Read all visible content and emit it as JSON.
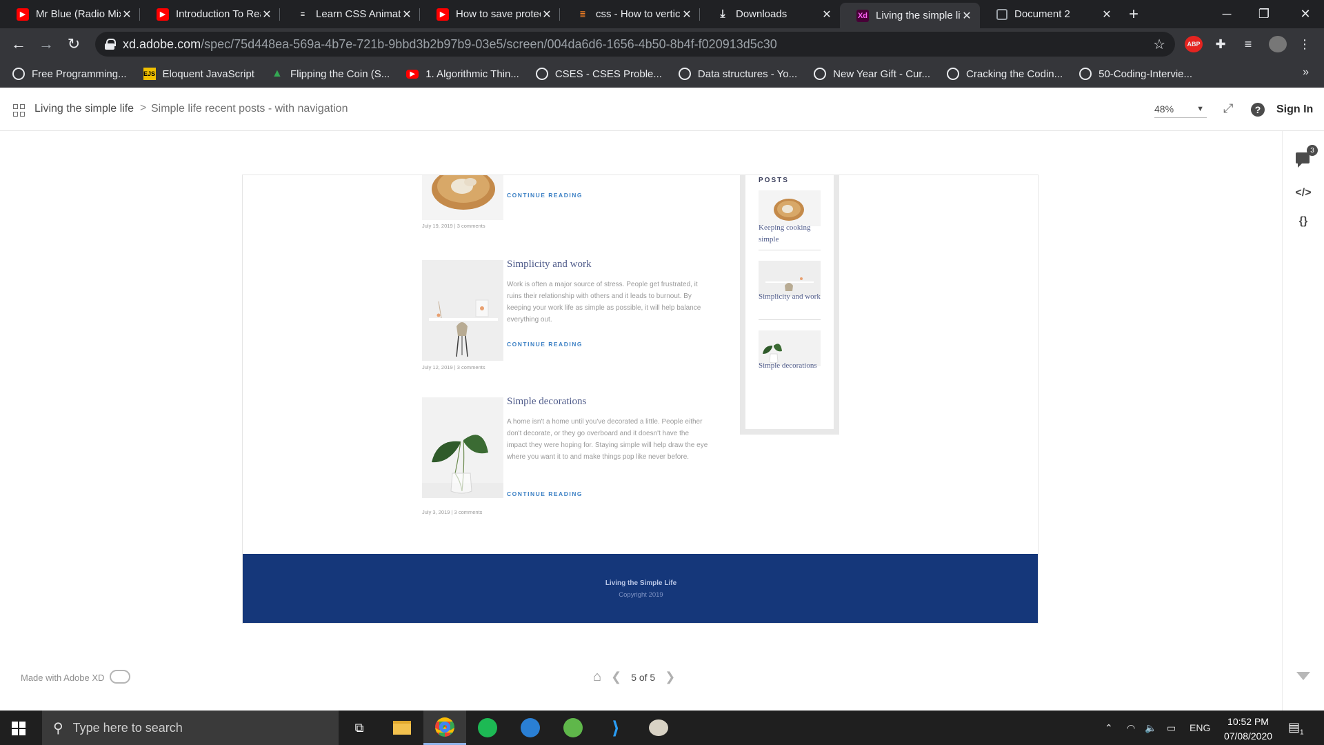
{
  "browser": {
    "tabs": [
      {
        "title": "Mr Blue (Radio Mix)",
        "icon": "youtube-icon",
        "color": "#ff0000"
      },
      {
        "title": "Introduction To React",
        "icon": "youtube-icon",
        "color": "#ff0000"
      },
      {
        "title": "Learn CSS Animation",
        "icon": "css-tricks-icon",
        "color": "#ffffff"
      },
      {
        "title": "How to save protected",
        "icon": "youtube-icon",
        "color": "#ff0000"
      },
      {
        "title": "css - How to vertically",
        "icon": "stackoverflow-icon",
        "color": "#f48024"
      },
      {
        "title": "Downloads",
        "icon": "download-icon",
        "color": "#e8eaed"
      },
      {
        "title": "Living the simple life",
        "icon": "xd-icon",
        "color": "#ff61f6",
        "active": true
      },
      {
        "title": "Document 2",
        "icon": "globe-icon",
        "color": "#9aa0a6"
      }
    ],
    "url_host": "xd.adobe.com",
    "url_path": "/spec/75d448ea-569a-4b7e-721b-9bbd3b2b97b9-03e5/screen/004da6d6-1656-4b50-8b4f-f020913d5c30",
    "ext_abp": "ABP",
    "bookmarks": [
      {
        "label": "Free Programming...",
        "icon": "globe-icon"
      },
      {
        "label": "Eloquent JavaScript",
        "icon": "ejs-icon",
        "badge": "EJS"
      },
      {
        "label": "Flipping the Coin (S...",
        "icon": "google-drive-icon"
      },
      {
        "label": "1. Algorithmic Thin...",
        "icon": "youtube-icon"
      },
      {
        "label": "CSES - CSES Proble...",
        "icon": "globe-icon"
      },
      {
        "label": "Data structures - Yo...",
        "icon": "globe-icon"
      },
      {
        "label": "New Year Gift - Cur...",
        "icon": "globe-icon"
      },
      {
        "label": "Cracking the Codin...",
        "icon": "globe-icon"
      },
      {
        "label": "50-Coding-Intervie...",
        "icon": "globe-icon"
      }
    ],
    "more": "»"
  },
  "xd": {
    "breadcrumb_project": "Living the simple life",
    "breadcrumb_sep": ">",
    "breadcrumb_screen": "Simple life recent posts - with navigation",
    "zoom": "48%",
    "sign_in": "Sign In",
    "comment_count": "3",
    "code_label": "</>",
    "braces_label": "{}",
    "made_with": "Made with Adobe XD",
    "pager": "5 of 5"
  },
  "artboard": {
    "posts": [
      {
        "title": "",
        "meta": "July 19, 2019  |  3 comments",
        "continue": "CONTINUE READING",
        "body": ""
      },
      {
        "title": "Simplicity and work",
        "meta": "July 12, 2019  |  3 comments",
        "continue": "CONTINUE READING",
        "body": "Work is often a major source of stress. People get frustrated, it ruins their relationship with others and it leads to burnout. By keeping your work life as simple as possible, it will help balance everything out."
      },
      {
        "title": "Simple decorations",
        "meta": "July 3, 2019  |  3 comments",
        "continue": "CONTINUE READING",
        "body": "A home isn't a home until you've decorated a little. People either don't decorate, or they go overboard and it doesn't have the impact they were hoping for. Staying simple will help draw the eye where you want it to and make things pop like never before."
      }
    ],
    "sidebar": {
      "title": "POSTS",
      "items": [
        "Keeping cooking simple",
        "Simplicity and work",
        "Simple decorations"
      ]
    },
    "footer": {
      "title": "Living the Simple Life",
      "copyright": "Copyright 2019"
    }
  },
  "taskbar": {
    "search_placeholder": "Type here to search",
    "lang": "ENG",
    "time": "10:52 PM",
    "date": "07/08/2020",
    "notifications": "1"
  }
}
